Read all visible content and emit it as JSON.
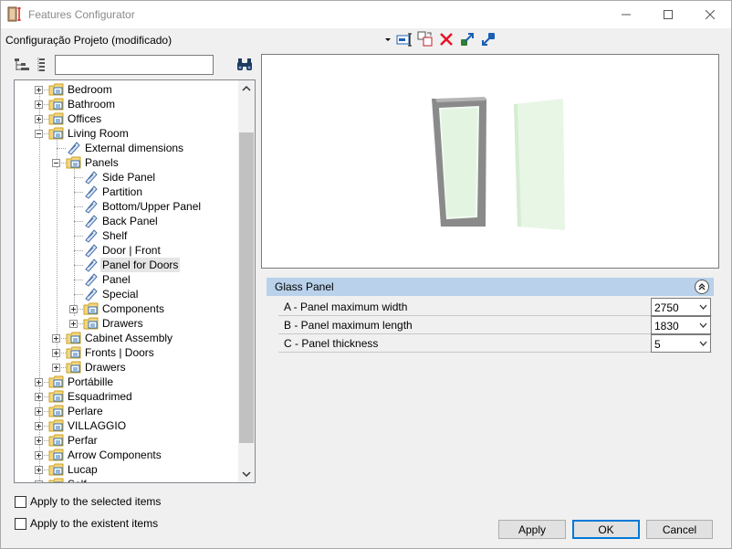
{
  "window": {
    "title": "Features Configurator"
  },
  "configuration": {
    "label": "Configuração Projeto (modificado)"
  },
  "search": {
    "value": "",
    "placeholder": ""
  },
  "tree": {
    "items": [
      {
        "label": "Bedroom",
        "level": 0,
        "toggle": "plus",
        "icon": "folder"
      },
      {
        "label": "Bathroom",
        "level": 0,
        "toggle": "plus",
        "icon": "folder"
      },
      {
        "label": "Offices",
        "level": 0,
        "toggle": "plus",
        "icon": "folder"
      },
      {
        "label": "Living Room",
        "level": 0,
        "toggle": "minus",
        "icon": "folder"
      },
      {
        "label": "External dimensions",
        "level": 1,
        "toggle": "",
        "icon": "leaf"
      },
      {
        "label": "Panels",
        "level": 1,
        "toggle": "minus",
        "icon": "folder"
      },
      {
        "label": "Side Panel",
        "level": 2,
        "toggle": "",
        "icon": "leaf"
      },
      {
        "label": "Partition",
        "level": 2,
        "toggle": "",
        "icon": "leaf"
      },
      {
        "label": "Bottom/Upper Panel",
        "level": 2,
        "toggle": "",
        "icon": "leaf"
      },
      {
        "label": "Back Panel",
        "level": 2,
        "toggle": "",
        "icon": "leaf"
      },
      {
        "label": "Shelf",
        "level": 2,
        "toggle": "",
        "icon": "leaf"
      },
      {
        "label": "Door | Front",
        "level": 2,
        "toggle": "",
        "icon": "leaf"
      },
      {
        "label": "Panel for Doors",
        "level": 2,
        "toggle": "",
        "icon": "leaf",
        "selected": true
      },
      {
        "label": "Panel",
        "level": 2,
        "toggle": "",
        "icon": "leaf"
      },
      {
        "label": "Special",
        "level": 2,
        "toggle": "",
        "icon": "leaf"
      },
      {
        "label": "Components",
        "level": 2,
        "toggle": "plus",
        "icon": "folder"
      },
      {
        "label": "Drawers",
        "level": 2,
        "toggle": "plus",
        "icon": "folder"
      },
      {
        "label": "Cabinet Assembly",
        "level": 1,
        "toggle": "plus",
        "icon": "folder"
      },
      {
        "label": "Fronts | Doors",
        "level": 1,
        "toggle": "plus",
        "icon": "folder"
      },
      {
        "label": "Drawers",
        "level": 1,
        "toggle": "plus",
        "icon": "folder"
      },
      {
        "label": "Portábille",
        "level": 0,
        "toggle": "plus",
        "icon": "folder"
      },
      {
        "label": "Esquadrimed",
        "level": 0,
        "toggle": "plus",
        "icon": "folder"
      },
      {
        "label": "Perlare",
        "level": 0,
        "toggle": "plus",
        "icon": "folder"
      },
      {
        "label": "VILLAGGIO",
        "level": 0,
        "toggle": "plus",
        "icon": "folder"
      },
      {
        "label": "Perfar",
        "level": 0,
        "toggle": "plus",
        "icon": "folder"
      },
      {
        "label": "Arrow Components",
        "level": 0,
        "toggle": "plus",
        "icon": "folder"
      },
      {
        "label": "Lucap",
        "level": 0,
        "toggle": "plus",
        "icon": "folder"
      },
      {
        "label": "Self",
        "level": 0,
        "toggle": "plus",
        "icon": "folder"
      }
    ]
  },
  "properties": {
    "group_title": "Glass Panel",
    "rows": [
      {
        "label": "A - Panel maximum width",
        "value": "2750"
      },
      {
        "label": "B - Panel maximum length",
        "value": "1830"
      },
      {
        "label": "C - Panel thickness",
        "value": "5"
      }
    ]
  },
  "options": {
    "apply_selected": "Apply to the selected items",
    "apply_existent": "Apply to the existent items"
  },
  "buttons": {
    "apply": "Apply",
    "ok": "OK",
    "cancel": "Cancel"
  },
  "colors": {
    "group_header": "#b9d1ea",
    "default_button_border": "#0078d7",
    "delete_icon": "#e81123"
  }
}
